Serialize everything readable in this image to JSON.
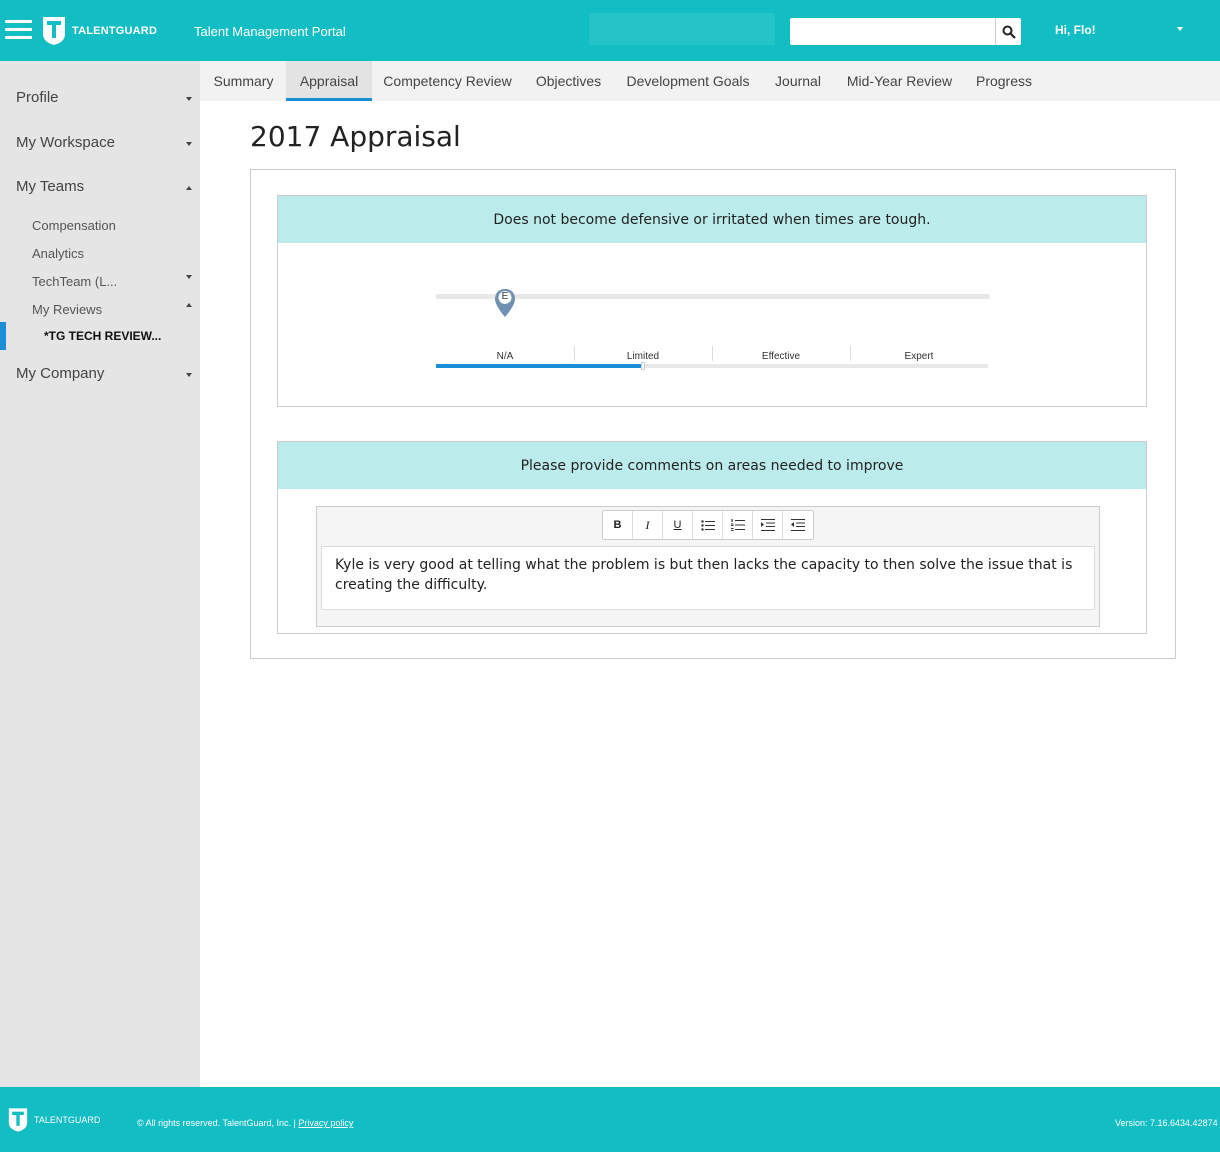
{
  "header": {
    "brand": "TALENTGUARD",
    "portal_title": "Talent Management Portal",
    "search_placeholder": "",
    "greeting": "Hi, Flo!",
    "icons": {
      "menu": "hamburger-icon",
      "search": "search-icon",
      "user_menu": "caret-down-icon"
    }
  },
  "sidebar": {
    "items": [
      {
        "label": "Profile",
        "state": "collapsed"
      },
      {
        "label": "My Workspace",
        "state": "collapsed"
      },
      {
        "label": "My Teams",
        "state": "expanded"
      },
      {
        "label": "Compensation"
      },
      {
        "label": "Analytics"
      },
      {
        "label": "TechTeam (L...",
        "state": "collapsed"
      },
      {
        "label": "My Reviews",
        "state": "expanded"
      },
      {
        "label": "*TG TECH REVIEW...",
        "active": true
      },
      {
        "label": "My Company",
        "state": "collapsed"
      }
    ]
  },
  "tabs": {
    "items": [
      {
        "label": "Summary"
      },
      {
        "label": "Appraisal",
        "selected": true
      },
      {
        "label": "Competency Review"
      },
      {
        "label": "Objectives"
      },
      {
        "label": "Development Goals"
      },
      {
        "label": "Journal"
      },
      {
        "label": "Mid-Year Review"
      },
      {
        "label": "Progress"
      }
    ]
  },
  "main": {
    "title": "2017 Appraisal",
    "question1": {
      "text": "Does not become defensive or irritated when times are tough.",
      "pin_label": "E",
      "scale": [
        "N/A",
        "Limited",
        "Effective",
        "Expert"
      ],
      "selected_fraction": 0.375
    },
    "question2": {
      "text": "Please provide comments on areas needed to improve",
      "toolbar": {
        "bold": "B",
        "italic": "I",
        "underline": "U",
        "icons": [
          "bold-icon",
          "italic-icon",
          "underline-icon",
          "bullet-list-icon",
          "numbered-list-icon",
          "indent-icon",
          "outdent-icon"
        ]
      },
      "comment": "Kyle is very good at telling what the problem is but then lacks the capacity to then solve the issue that is creating the difficulty."
    }
  },
  "footer": {
    "brand": "TALENTGUARD",
    "copyright": "© All rights reserved. TalentGuard, Inc. | ",
    "privacy": "Privacy policy",
    "version": "Version: 7.16.6434.42874"
  },
  "colors": {
    "brand": "#12bec4",
    "accent": "#1a8fd8",
    "question_header": "#bbebeb",
    "sidebar_bg": "#e5e5e5"
  }
}
